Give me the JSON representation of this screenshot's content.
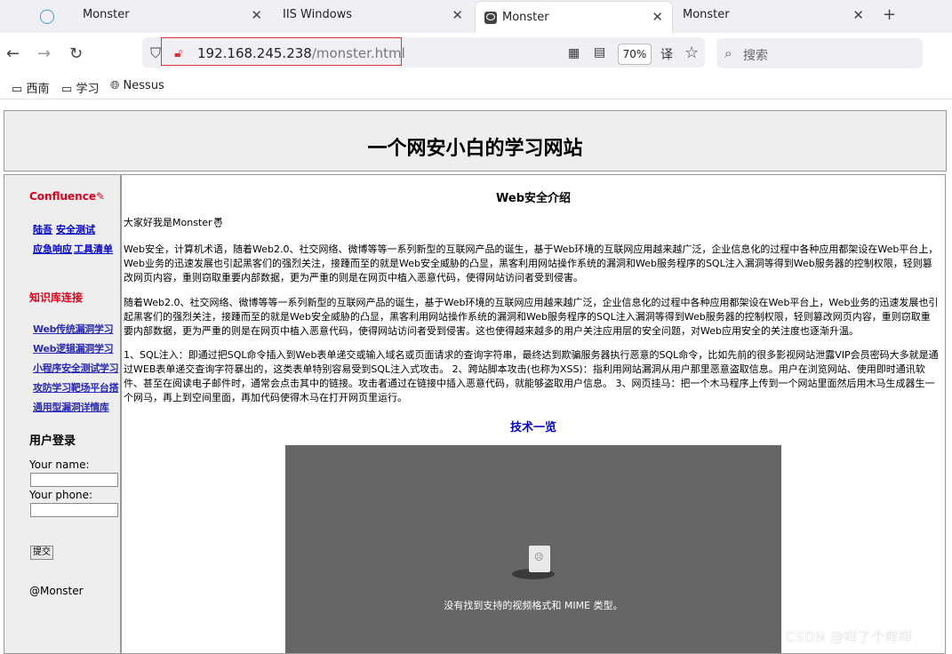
{
  "tabs": [
    {
      "title": "Monster"
    },
    {
      "title": "IIS Windows"
    },
    {
      "title": "Monster"
    },
    {
      "title": "Monster"
    }
  ],
  "nav": {
    "url_host": "192.168.245.238",
    "url_path": "/monster.html",
    "zoom": "70%",
    "search_placeholder": "搜索"
  },
  "bookmarks": [
    "西南",
    "学习",
    "Nessus"
  ],
  "site": {
    "header_title": "一个网安小白的学习网站",
    "sidebar": {
      "confluence": "Confluence",
      "links": [
        "陆吾",
        "安全测试",
        "应急响应",
        "工具清单"
      ],
      "kb_title": "知识库连接",
      "kb_links": [
        "Web传统漏洞学习",
        "Web逻辑漏洞学习",
        "小程序安全测试学习",
        "攻防学习靶场平台搭",
        "通用型漏洞详情库"
      ],
      "login_title": "用户登录",
      "name_label": "Your name:",
      "phone_label": "Your phone:",
      "submit_label": "提交",
      "signature": "@Monster"
    },
    "content": {
      "title": "Web安全介绍",
      "greeting": "大家好我是Monster",
      "p1": "Web安全，计算机术语，随着Web2.0、社交网络、微博等等一系列新型的互联网产品的诞生，基于Web环境的互联网应用越来越广泛，企业信息化的过程中各种应用都架设在Web平台上，Web业务的迅速发展也引起黑客们的强烈关注，接踵而至的就是Web安全威胁的凸显，黑客利用网站操作系统的漏洞和Web服务程序的SQL注入漏洞等得到Web服务器的控制权限，轻则篡改网页内容，重则窃取重要内部数据，更为严重的则是在网页中植入恶意代码，使得网站访问者受到侵害。",
      "p2": "随着Web2.0、社交网络、微博等等一系列新型的互联网产品的诞生，基于Web环境的互联网应用越来越广泛，企业信息化的过程中各种应用都架设在Web平台上，Web业务的迅速发展也引起黑客们的强烈关注，接踵而至的就是Web安全威胁的凸显，黑客利用网站操作系统的漏洞和Web服务程序的SQL注入漏洞等得到Web服务器的控制权限，轻则篡改网页内容，重则窃取重要内部数据，更为严重的则是在网页中植入恶意代码，使得网站访问者受到侵害。这也使得越来越多的用户关注应用层的安全问题，对Web应用安全的关注度也逐渐升温。",
      "p3": "1、SQL注入：即通过把SQL命令插入到Web表单递交或输入域名或页面请求的查询字符串，最终达到欺骗服务器执行恶意的SQL命令，比如先前的很多影视网站泄露VIP会员密码大多就是通过WEB表单递交查询字符暴出的，这类表单特别容易受到SQL注入式攻击。 2、跨站脚本攻击(也称为XSS)：指利用网站漏洞从用户那里恶意盗取信息。用户在浏览网站、使用即时通讯软件、甚至在阅读电子邮件时，通常会点击其中的链接。攻击者通过在链接中插入恶意代码，就能够盗取用户信息。 3、网页挂马：把一个木马程序上传到一个网站里面然后用木马生成器生一个网马，再上到空间里面，再加代码使得木马在打开网页里运行。",
      "tech_title": "技术一览",
      "video_message": "没有找到支持的视频格式和 MIME 类型。"
    }
  },
  "watermark": "CSDN @咩了个咩咩"
}
